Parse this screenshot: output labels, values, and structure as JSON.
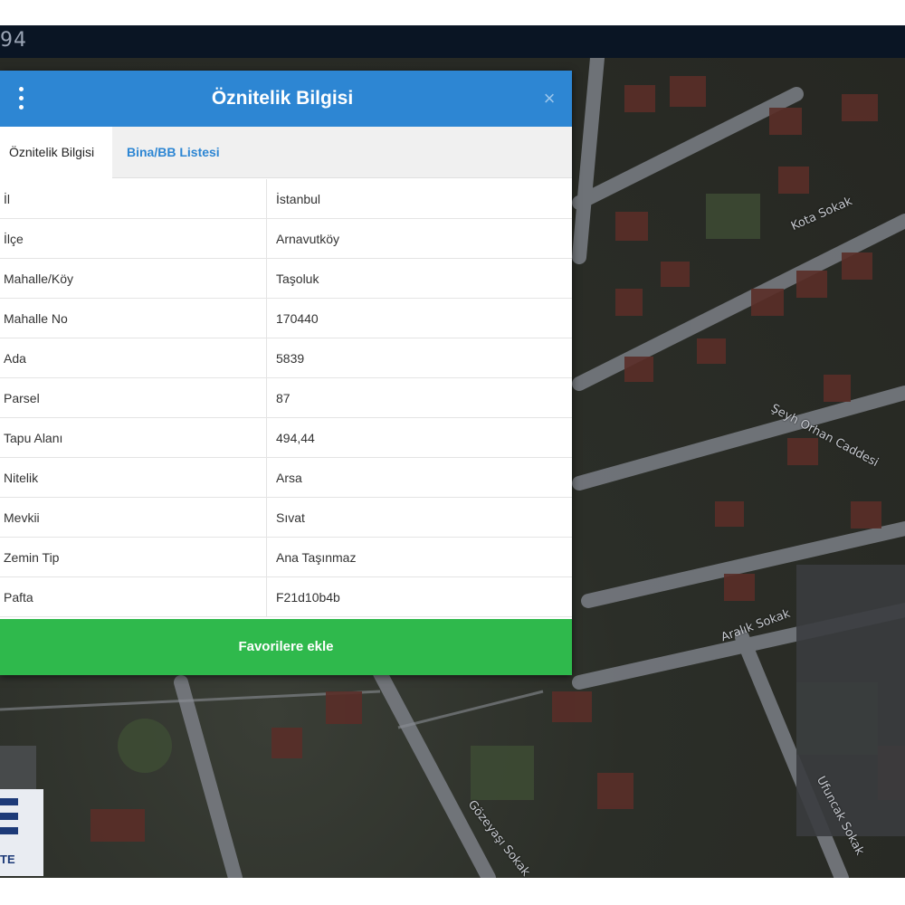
{
  "topbar": {
    "text": "94"
  },
  "panel": {
    "title": "Öznitelik Bilgisi",
    "close_label": "×",
    "tabs": [
      {
        "label": "Öznitelik Bilgisi",
        "active": true
      },
      {
        "label": "Bina/BB Listesi",
        "active": false
      }
    ],
    "rows": [
      {
        "key": "İl",
        "value": "İstanbul"
      },
      {
        "key": "İlçe",
        "value": "Arnavutköy"
      },
      {
        "key": "Mahalle/Köy",
        "value": "Taşoluk"
      },
      {
        "key": "Mahalle No",
        "value": "170440"
      },
      {
        "key": "Ada",
        "value": "5839"
      },
      {
        "key": "Parsel",
        "value": "87"
      },
      {
        "key": "Tapu Alanı",
        "value": "494,44"
      },
      {
        "key": "Nitelik",
        "value": "Arsa"
      },
      {
        "key": "Mevkii",
        "value": "Sıvat"
      },
      {
        "key": "Zemin Tip",
        "value": "Ana Taşınmaz"
      },
      {
        "key": "Pafta",
        "value": "F21d10b4b"
      }
    ],
    "favorite_button": "Favorilere ekle"
  },
  "map": {
    "streets": [
      "Kota Sokak",
      "Şeyh Orhan Caddesi",
      "Aralık Sokak",
      "Gözeyaşı Sokak",
      "Ufuncak Sokak"
    ]
  },
  "logo": {
    "text": "TE"
  },
  "colors": {
    "header": "#2d86d3",
    "button": "#2fb94c",
    "tab_link": "#2d86d3"
  }
}
